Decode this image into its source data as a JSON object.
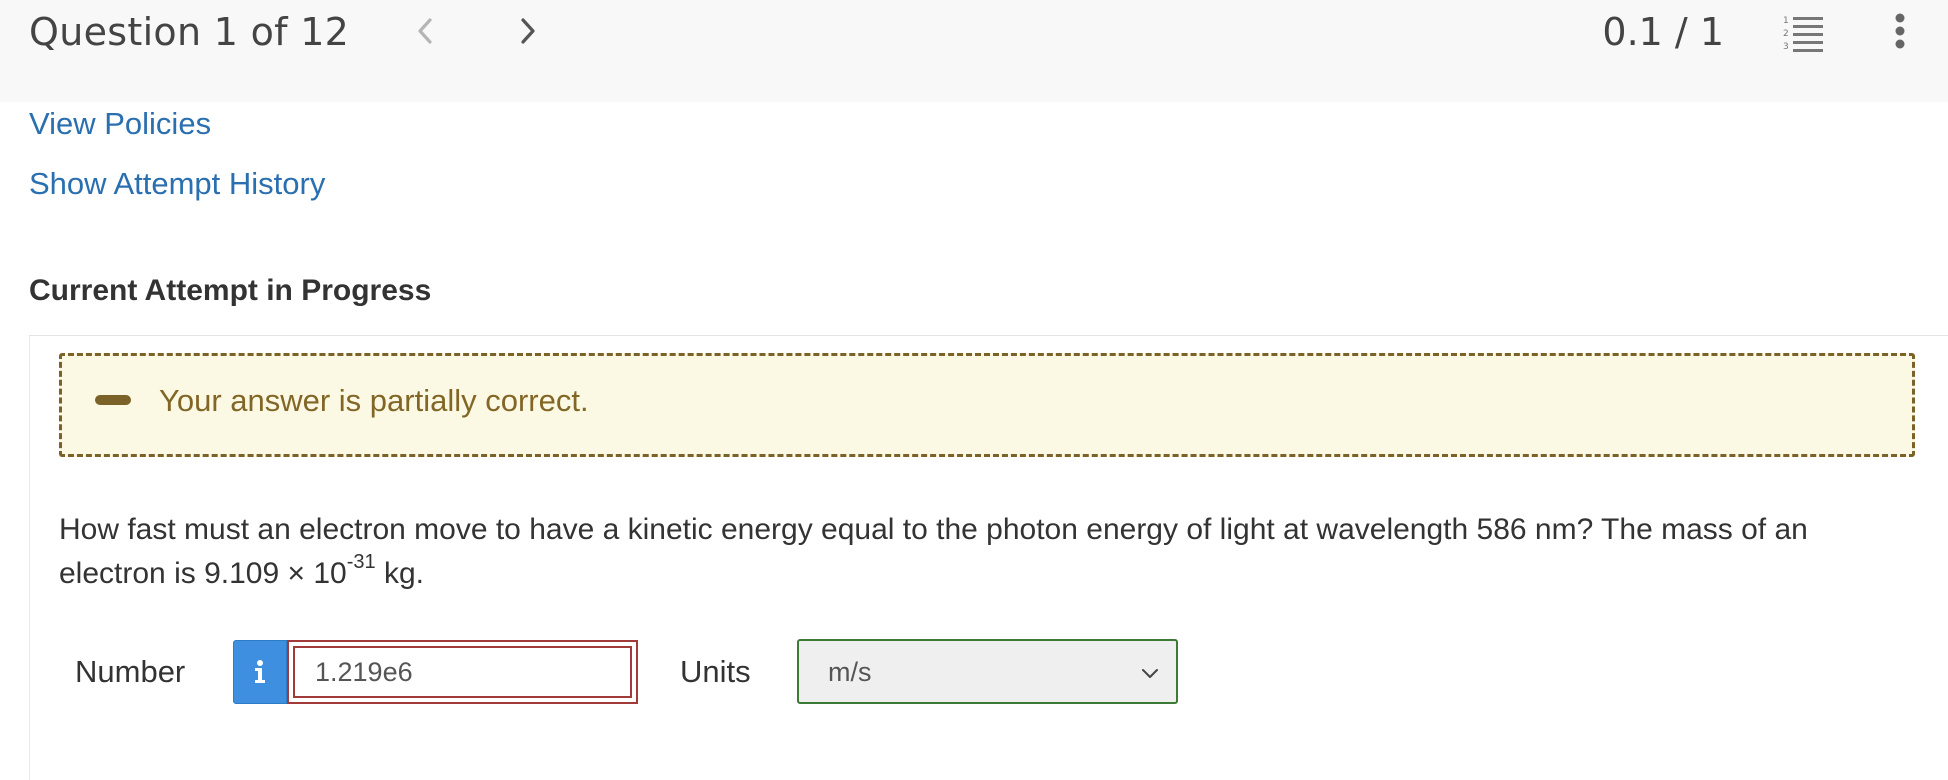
{
  "header": {
    "question_label": "Question 1 of 12",
    "score": "0.1 / 1"
  },
  "links": {
    "view_policies": "View Policies",
    "attempt_history": "Show Attempt History"
  },
  "attempt": {
    "section_title": "Current Attempt in Progress",
    "feedback": "Your answer is partially correct."
  },
  "question": {
    "text": "How fast must an electron move to have a kinetic energy equal to the photon energy of light at wavelength 586 nm? The mass of an electron is 9.109 × 10",
    "exponent": "-31",
    "unit_suffix": " kg."
  },
  "answer": {
    "number_label": "Number",
    "info_symbol": "i",
    "number_value": "1.219e6",
    "units_label": "Units",
    "units_selected": "m/s"
  },
  "colors": {
    "link": "#2a6fb0",
    "feedback_bg": "#fbf8e3",
    "feedback_border": "#7a6229",
    "info_button": "#3f8fe0",
    "input_error_border": "#a23a3a",
    "select_border": "#3c7a36"
  },
  "icons": {
    "prev": "chevron-left-icon",
    "next": "chevron-right-icon",
    "list": "numbered-list-icon",
    "more": "kebab-menu-icon",
    "feedback": "minus-icon",
    "info": "info-icon",
    "dropdown": "chevron-down-icon"
  }
}
